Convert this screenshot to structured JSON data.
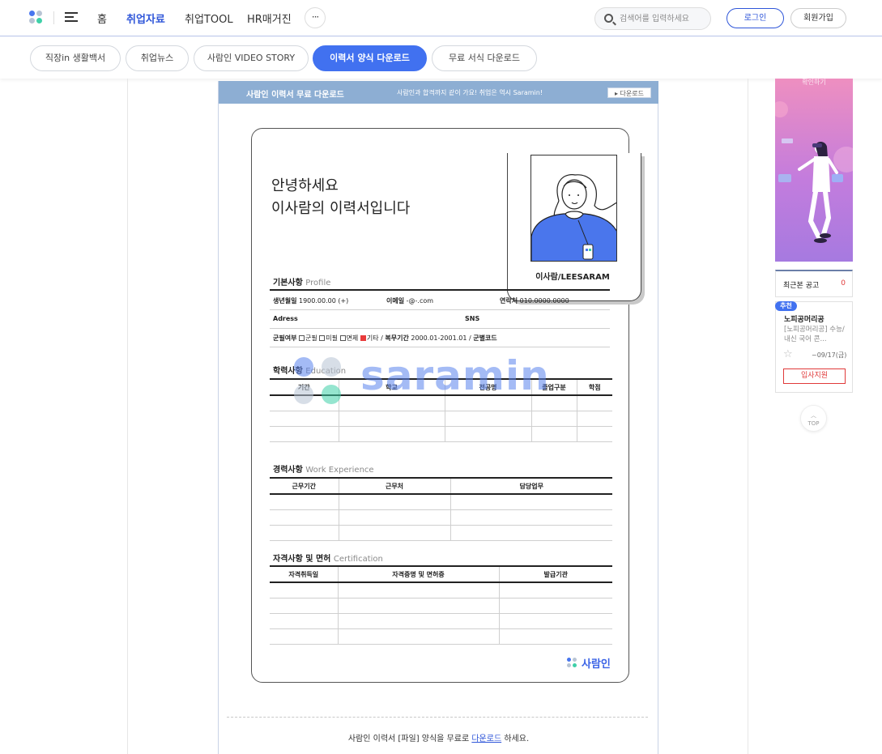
{
  "header": {
    "nav": [
      "홈",
      "취업자료",
      "취업TOOL",
      "HR매거진"
    ],
    "more": "···",
    "search_placeholder": "검색어를 입력하세요",
    "login": "로그인",
    "join": "회원가입"
  },
  "subnav": {
    "items": [
      "직장in 생활백서",
      "취업뉴스",
      "사람인 VIDEO STORY",
      "이력서 양식 다운로드",
      "무료 서식 다운로드"
    ],
    "active": "이력서 양식 다운로드"
  },
  "banner": {
    "title": "사람인 이력서 무료 다운로드",
    "subtitle": "사람인과 합격까지 같이 가요! 취업은 역시 Saramin!",
    "button": "다운로드"
  },
  "resume": {
    "greeting_line1": "안녕하세요",
    "greeting_line2": "이사람의 이력서입니다",
    "photo_name": "이사람/LEESARAM",
    "profile": {
      "title": "기본사항",
      "title_en": "Profile",
      "birth_label": "생년월일",
      "birth_value": "1900.00.00 (+)",
      "email_label": "이메일",
      "email_value": "-@-.com",
      "phone_label": "연락처",
      "phone_value": "010.0000.0000",
      "address_label": "Adress",
      "sns_label": "SNS",
      "military_label": "군필여부",
      "military_opts": [
        "군필",
        "미필",
        "면제",
        "기타"
      ],
      "service_label": "복무기간",
      "service_value": "2000.01-2001.01",
      "code_label": "군별코드"
    },
    "education": {
      "title": "학력사항",
      "title_en": "Education",
      "columns": [
        "기간",
        "학교",
        "전공명",
        "졸업구분",
        "학점"
      ]
    },
    "work": {
      "title": "경력사항",
      "title_en": "Work Experience",
      "columns": [
        "근무기간",
        "근무처",
        "담당업무"
      ]
    },
    "cert": {
      "title": "자격사항 및 면허",
      "title_en": "Certification",
      "columns": [
        "자격취득일",
        "자격증명 및 면허증",
        "발급기관"
      ]
    },
    "watermark": "saramin",
    "card_logo": "사람인"
  },
  "footer": {
    "before": "사람인 이력서 [파일] 양식을 무료로",
    "link": "다운로드",
    "after": "하세요."
  },
  "sidebar": {
    "ad_caption": "확인하기",
    "recent_label": "최근본 공고",
    "recent_count": "0",
    "badge": "추천",
    "company": "노피공머리공",
    "desc": "[노피공머리공] 수능/내신 국어 콘...",
    "deadline": "~09/17(금)",
    "apply": "입사지원",
    "top": "TOP"
  },
  "colors": {
    "brand_blue": "#4171f0",
    "banner": "#8daed3",
    "accent_red": "#e03a3a"
  }
}
